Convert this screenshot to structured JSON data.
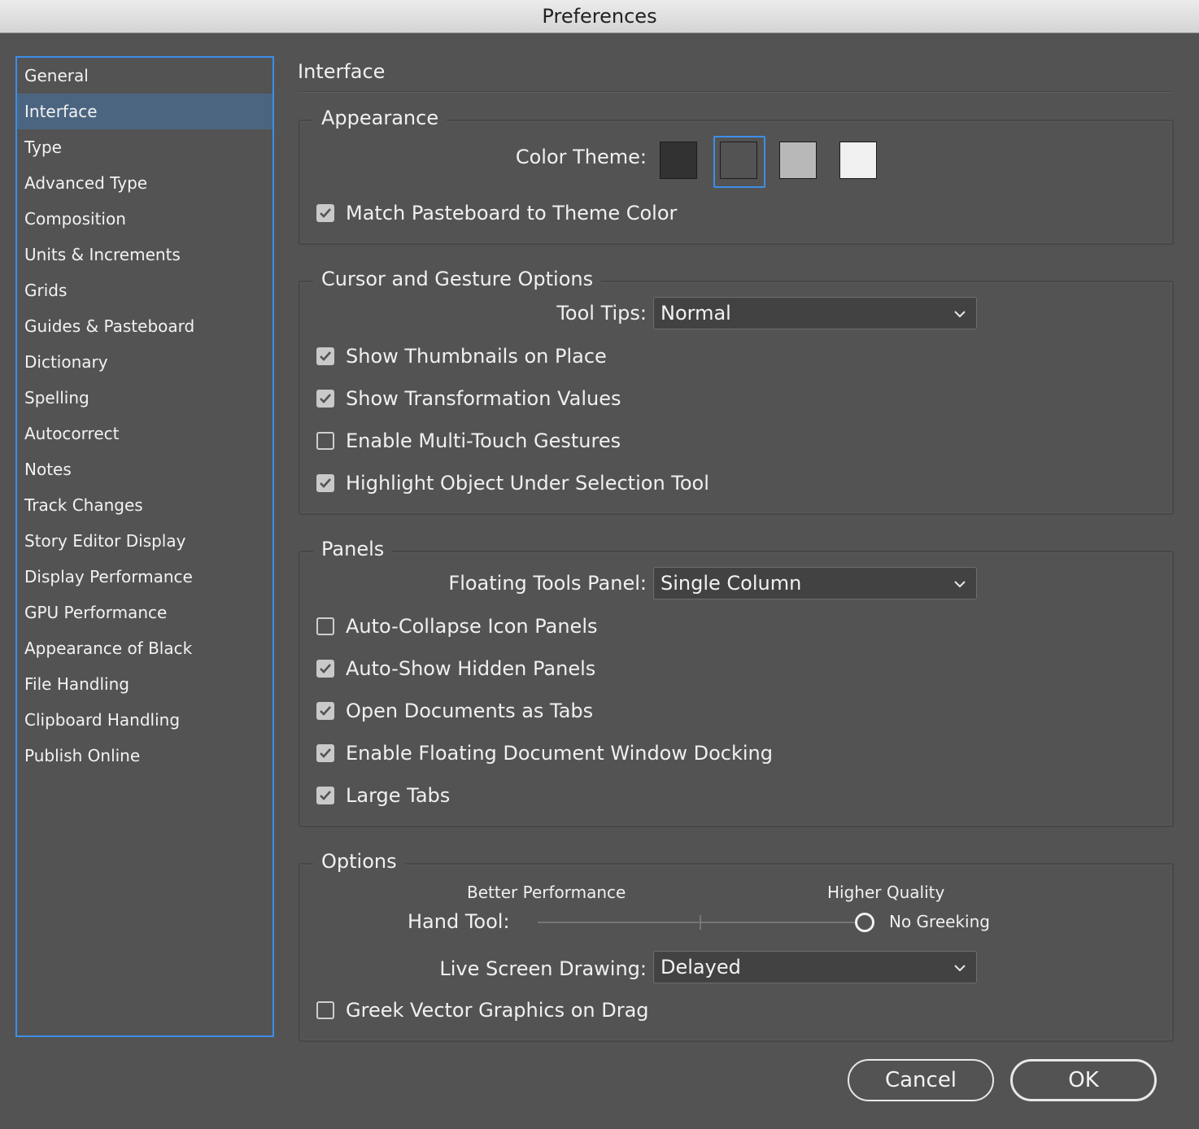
{
  "window": {
    "title": "Preferences"
  },
  "sidebar": {
    "items": [
      {
        "label": "General",
        "selected": false
      },
      {
        "label": "Interface",
        "selected": true
      },
      {
        "label": "Type",
        "selected": false
      },
      {
        "label": "Advanced Type",
        "selected": false
      },
      {
        "label": "Composition",
        "selected": false
      },
      {
        "label": "Units & Increments",
        "selected": false
      },
      {
        "label": "Grids",
        "selected": false
      },
      {
        "label": "Guides & Pasteboard",
        "selected": false
      },
      {
        "label": "Dictionary",
        "selected": false
      },
      {
        "label": "Spelling",
        "selected": false
      },
      {
        "label": "Autocorrect",
        "selected": false
      },
      {
        "label": "Notes",
        "selected": false
      },
      {
        "label": "Track Changes",
        "selected": false
      },
      {
        "label": "Story Editor Display",
        "selected": false
      },
      {
        "label": "Display Performance",
        "selected": false
      },
      {
        "label": "GPU Performance",
        "selected": false
      },
      {
        "label": "Appearance of Black",
        "selected": false
      },
      {
        "label": "File Handling",
        "selected": false
      },
      {
        "label": "Clipboard Handling",
        "selected": false
      },
      {
        "label": "Publish Online",
        "selected": false
      }
    ]
  },
  "main": {
    "heading": "Interface",
    "appearance": {
      "title": "Appearance",
      "color_theme_label": "Color Theme:",
      "themes": [
        {
          "color": "#323232",
          "selected": false
        },
        {
          "color": "#535353",
          "selected": true
        },
        {
          "color": "#b8b8b8",
          "selected": false
        },
        {
          "color": "#f0f0f0",
          "selected": false
        }
      ],
      "match_pasteboard": {
        "label": "Match Pasteboard to Theme Color",
        "checked": true
      }
    },
    "cursor": {
      "title": "Cursor and Gesture Options",
      "tool_tips_label": "Tool Tips:",
      "tool_tips_value": "Normal",
      "show_thumbnails": {
        "label": "Show Thumbnails on Place",
        "checked": true
      },
      "show_transformation": {
        "label": "Show Transformation Values",
        "checked": true
      },
      "multi_touch": {
        "label": "Enable Multi-Touch Gestures",
        "checked": false
      },
      "highlight_object": {
        "label": "Highlight Object Under Selection Tool",
        "checked": true
      }
    },
    "panels": {
      "title": "Panels",
      "floating_tools_label": "Floating Tools Panel:",
      "floating_tools_value": "Single Column",
      "auto_collapse": {
        "label": "Auto-Collapse Icon Panels",
        "checked": false
      },
      "auto_show": {
        "label": "Auto-Show Hidden Panels",
        "checked": true
      },
      "open_as_tabs": {
        "label": "Open Documents as Tabs",
        "checked": true
      },
      "floating_docking": {
        "label": "Enable Floating Document Window Docking",
        "checked": true
      },
      "large_tabs": {
        "label": "Large Tabs",
        "checked": true
      }
    },
    "options": {
      "title": "Options",
      "better_performance": "Better Performance",
      "higher_quality": "Higher Quality",
      "hand_tool_label": "Hand Tool:",
      "hand_tool_level": 1.0,
      "hand_tool_value": "No Greeking",
      "live_screen_label": "Live Screen Drawing:",
      "live_screen_value": "Delayed",
      "greek_vector": {
        "label": "Greek Vector Graphics on Drag",
        "checked": false
      }
    }
  },
  "buttons": {
    "cancel": "Cancel",
    "ok": "OK"
  },
  "colors": {
    "background": "#535353",
    "accent": "#3d8ee8",
    "selected_row": "#4b6581"
  }
}
